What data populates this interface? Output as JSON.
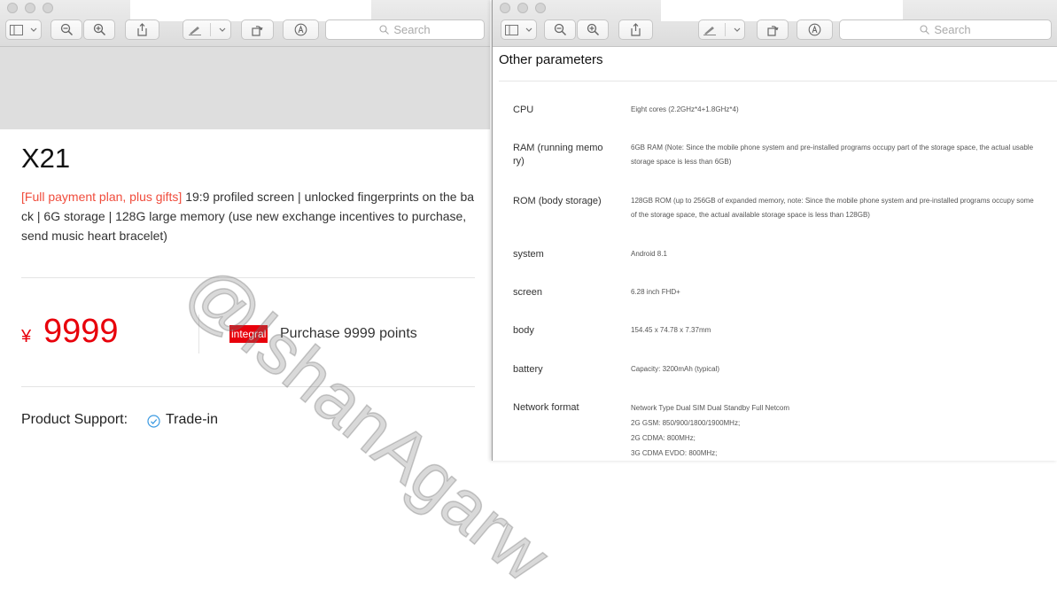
{
  "toolbar": {
    "search_placeholder": "Search"
  },
  "left_page": {
    "product_title": "X21",
    "promo_text": "[Full payment plan, plus gifts]",
    "description": " 19:9 profiled screen | unlocked fingerprints on the back | 6G storage | 128G large memory (use new exchange incentives to purchase, send music heart bracelet)",
    "currency_symbol": "¥",
    "price": "9999",
    "badge_label": "integral",
    "points_text": "Purchase 9999 points",
    "support_label": "Product Support:",
    "support_item": "Trade-in"
  },
  "right_page": {
    "section_title": "Other parameters",
    "params": [
      {
        "name": "CPU",
        "lines": [
          "Eight cores (2.2GHz*4+1.8GHz*4)"
        ]
      },
      {
        "name": "RAM (running memory)",
        "lines": [
          "6GB RAM (Note: Since the mobile phone system and pre-installed programs occupy part of the storage space, the actual usable",
          "storage space is less than 6GB)"
        ]
      },
      {
        "name": "ROM (body storage)",
        "lines": [
          "128GB ROM (up to 256GB of expanded memory, note: Since the mobile phone system and pre-installed programs occupy some",
          "of the storage space, the actual available storage space is less than 128GB)"
        ]
      },
      {
        "name": "system",
        "lines": [
          "Android 8.1"
        ]
      },
      {
        "name": "screen",
        "lines": [
          "6.28 inch FHD+"
        ]
      },
      {
        "name": "body",
        "lines": [
          "154.45 x 74.78 x 7.37mm"
        ]
      },
      {
        "name": "battery",
        "lines": [
          "Capacity: 3200mAh (typical)"
        ]
      },
      {
        "name": "Network format",
        "lines": [
          "Network Type Dual SIM Dual Standby Full Netcom",
          "2G GSM: 850/900/1800/1900MHz;",
          "2G CDMA: 800MHz;",
          "3G CDMA EVDO: 800MHz;"
        ]
      }
    ]
  },
  "watermark": "@IshanAgarw",
  "colors": {
    "price_red": "#e8000b",
    "promo_red": "#f04c3c",
    "check_blue": "#3b9ae1"
  }
}
